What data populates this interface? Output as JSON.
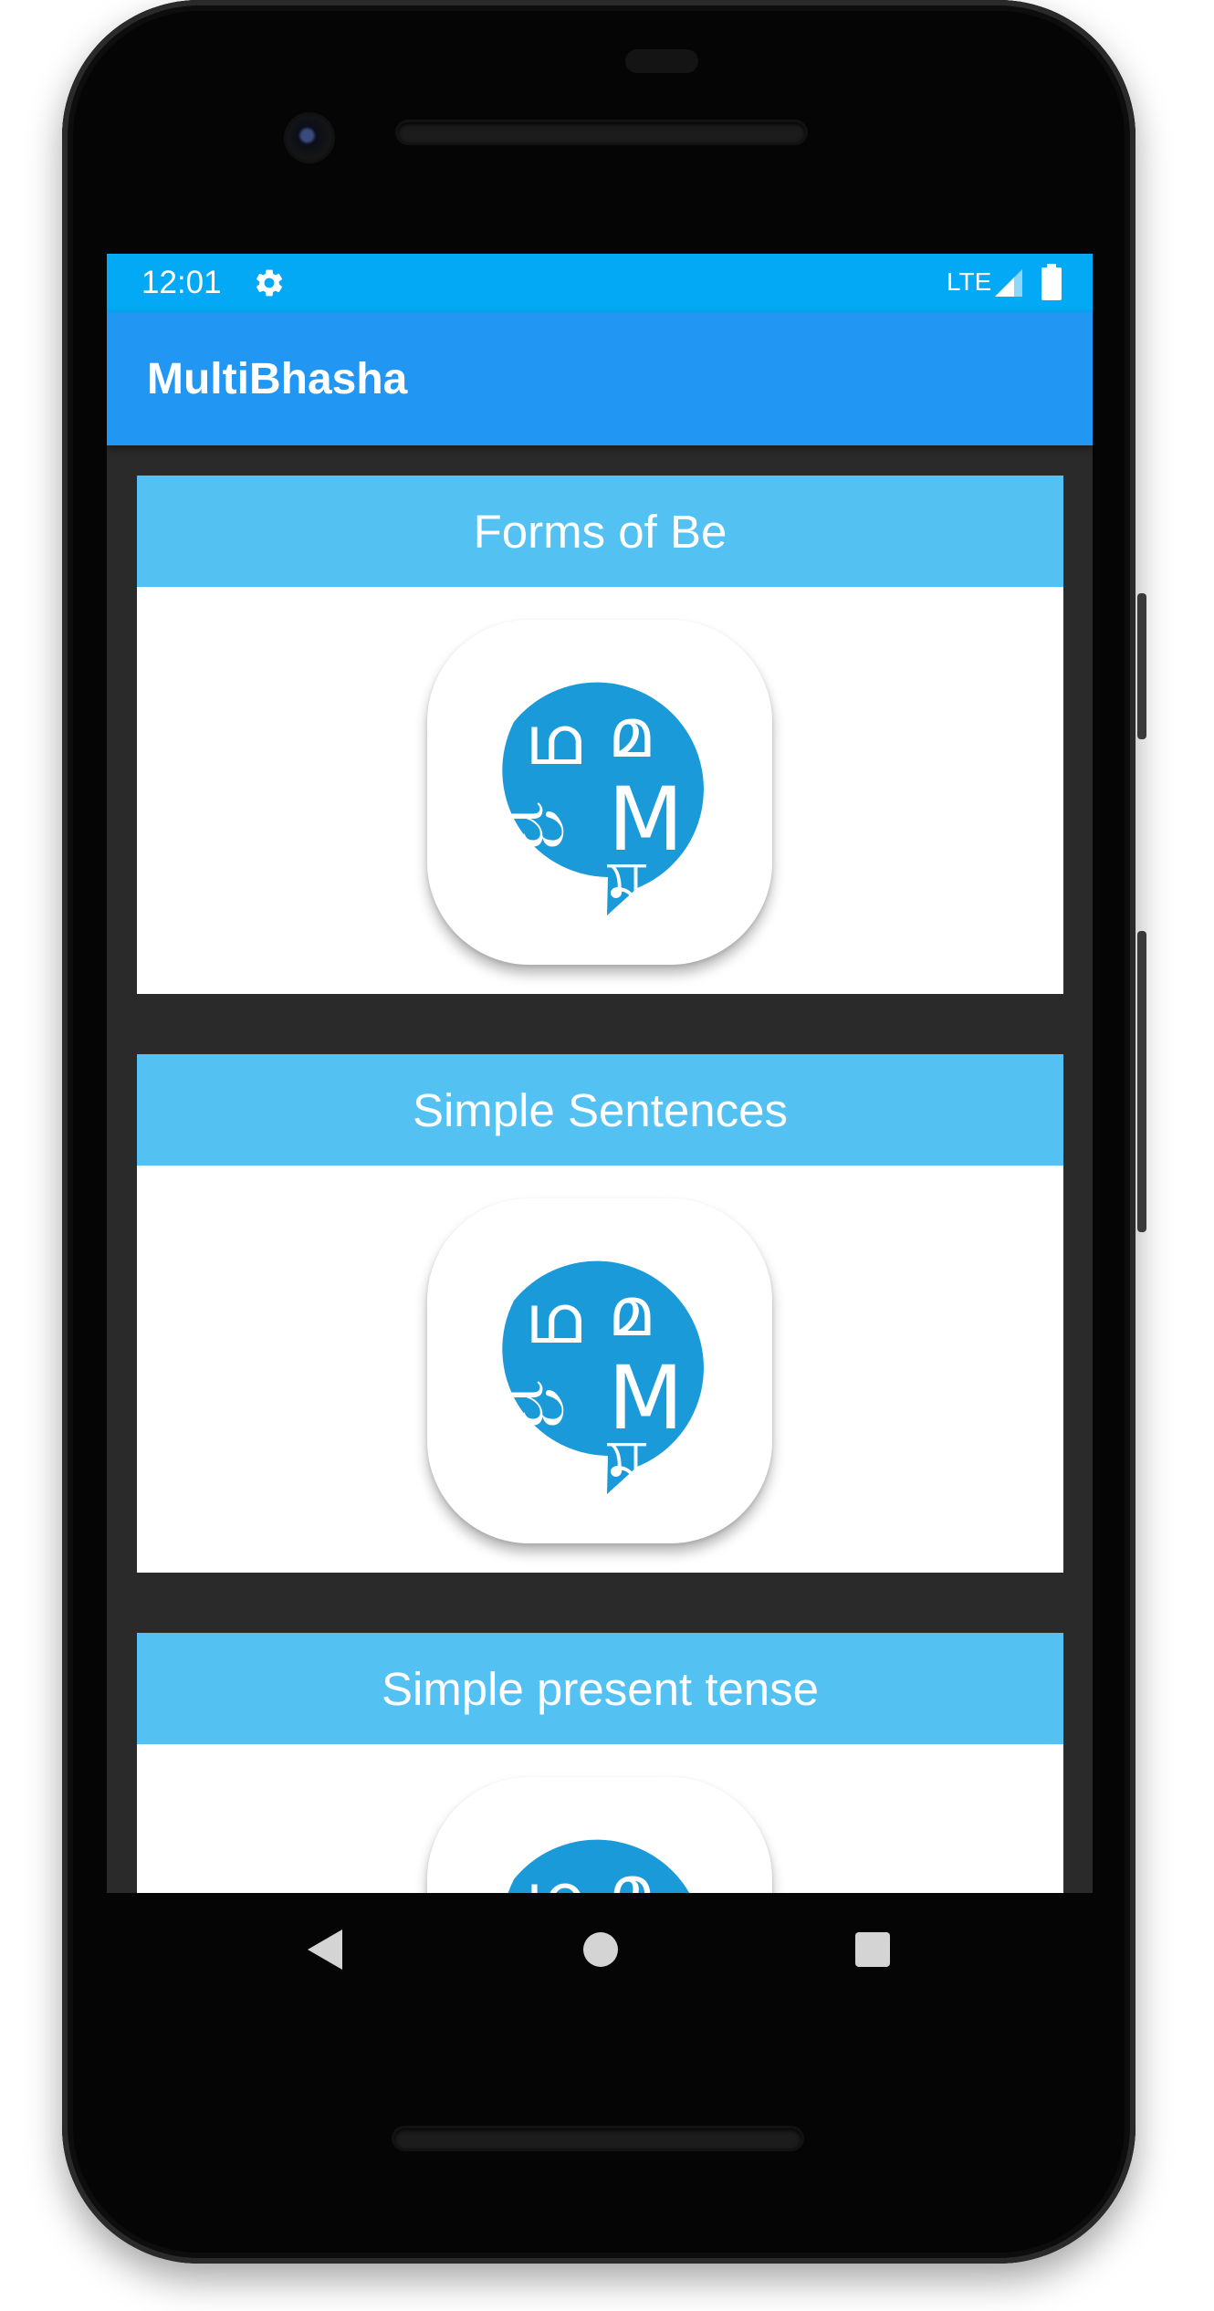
{
  "status_bar": {
    "time": "12:01",
    "network": "LTE",
    "icons": [
      "settings-gear-icon",
      "signal-icon",
      "battery-icon"
    ]
  },
  "app_bar": {
    "title": "MultiBhasha"
  },
  "cards": [
    {
      "title": "Forms of Be",
      "icon": "multibhasha-logo-icon"
    },
    {
      "title": "Simple Sentences",
      "icon": "multibhasha-logo-icon"
    },
    {
      "title": "Simple present tense",
      "icon": "multibhasha-logo-icon"
    }
  ],
  "logo": {
    "glyphs": [
      "ഥ",
      "മ",
      "ಮ",
      "M",
      "स",
      "ম"
    ]
  },
  "nav_bar": {
    "icons": [
      "back-icon",
      "home-icon",
      "recents-icon"
    ]
  },
  "colors": {
    "status_bar": "#03a9f4",
    "app_bar": "#2196f3",
    "card_header": "#54c1f3",
    "logo_bubble": "#1a9ad9",
    "screen_bg": "#2a2a2a"
  }
}
